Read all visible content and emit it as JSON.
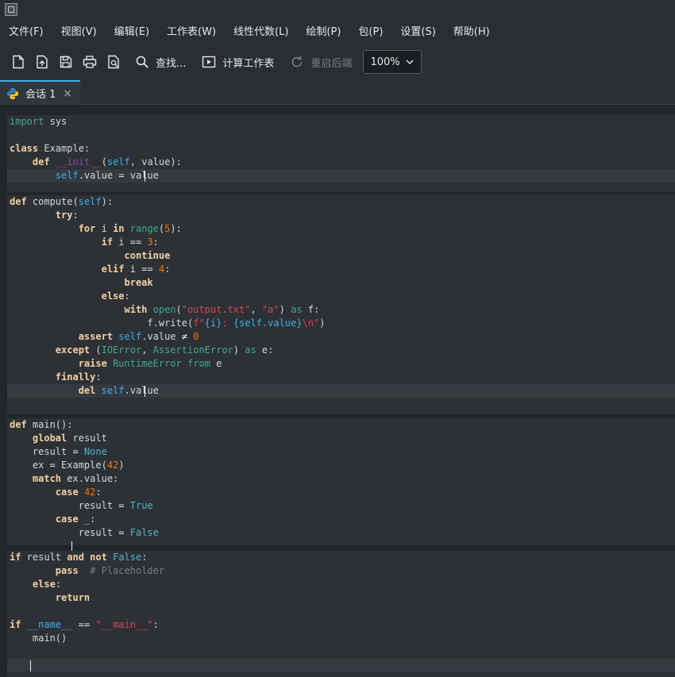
{
  "menu": [
    "文件(F)",
    "视图(V)",
    "编辑(E)",
    "工作表(W)",
    "线性代数(L)",
    "绘制(P)",
    "包(P)",
    "设置(S)",
    "帮助(H)"
  ],
  "toolbar": {
    "find_label": "查找...",
    "evaluate_label": "计算工作表",
    "restart_label": "重启后端",
    "zoom_value": "100%"
  },
  "tab": {
    "label": "会话 1",
    "close": "×"
  },
  "icons": [
    "app-icon",
    "new-file-icon",
    "open-file-icon",
    "save-icon",
    "print-icon",
    "print-preview-icon",
    "search-icon",
    "evaluate-icon",
    "restart-icon",
    "python-icon",
    "close-icon",
    "chevron-down-icon"
  ],
  "cells": [
    [
      "import sys",
      "",
      "class Example:",
      "    def __init__(self, value):",
      "        self.value = value"
    ],
    [
      "def compute(self):",
      "        try:",
      "            for i in range(5):",
      "                if i == 3:",
      "                    continue",
      "                elif i == 4:",
      "                    break",
      "                else:",
      "                    with open(\"output.txt\", \"a\") as f:",
      "                        f.write(f\"{i}: {self.value}\\n\")",
      "            assert self.value ≠ 0",
      "        except (IOError, AssertionError) as e:",
      "            raise RuntimeError from e",
      "        finally:",
      "            del self.value",
      ""
    ],
    [
      "def main():",
      "    global result",
      "    result = None",
      "    ex = Example(42)",
      "    match ex.value:",
      "        case 42:",
      "            result = True",
      "        case _:",
      "            result = False",
      ""
    ],
    [
      "if result and not False:",
      "        pass  # Placeholder",
      "    else:",
      "        return",
      "",
      "if __name__ == \"__main__\":",
      "    main()",
      "",
      ""
    ]
  ]
}
